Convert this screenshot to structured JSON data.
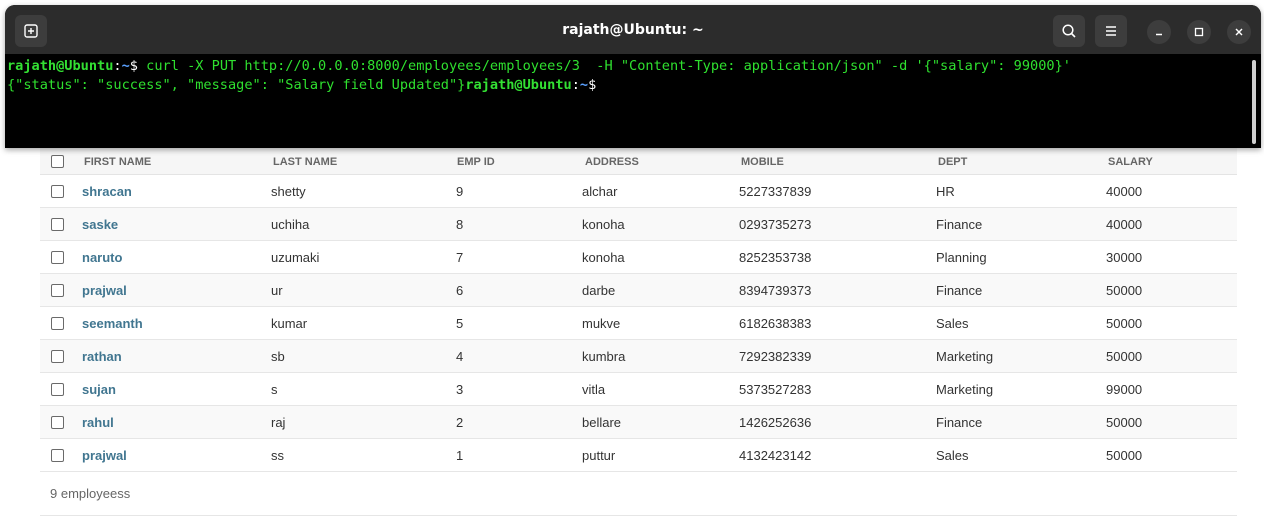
{
  "terminal": {
    "title": "rajath@Ubuntu: ~",
    "prompt_user": "rajath@Ubuntu",
    "prompt_sep": ":",
    "prompt_path": "~",
    "prompt_symbol": "$ ",
    "command": "curl -X PUT http://0.0.0.0:8000/employees/employees/3  -H \"Content-Type: application/json\" -d '{\"salary\": 99000}'",
    "output": "{\"status\": \"success\", \"message\": \"Salary field Updated\"}",
    "icons": {
      "new_tab": "new-tab-icon",
      "search": "search-icon",
      "menu": "hamburger-menu-icon",
      "minimize": "minimize-icon",
      "maximize": "maximize-icon",
      "close": "close-icon"
    }
  },
  "table": {
    "headers": [
      "FIRST NAME",
      "LAST NAME",
      "EMP ID",
      "ADDRESS",
      "MOBILE",
      "DEPT",
      "SALARY"
    ],
    "rows": [
      {
        "first": "shracan",
        "last": "shetty",
        "id": "9",
        "address": "alchar",
        "mobile": "5227337839",
        "dept": "HR",
        "salary": "40000"
      },
      {
        "first": "saske",
        "last": "uchiha",
        "id": "8",
        "address": "konoha",
        "mobile": "0293735273",
        "dept": "Finance",
        "salary": "40000"
      },
      {
        "first": "naruto",
        "last": "uzumaki",
        "id": "7",
        "address": "konoha",
        "mobile": "8252353738",
        "dept": "Planning",
        "salary": "30000"
      },
      {
        "first": "prajwal",
        "last": "ur",
        "id": "6",
        "address": "darbe",
        "mobile": "8394739373",
        "dept": "Finance",
        "salary": "50000"
      },
      {
        "first": "seemanth",
        "last": "kumar",
        "id": "5",
        "address": "mukve",
        "mobile": "6182638383",
        "dept": "Sales",
        "salary": "50000"
      },
      {
        "first": "rathan",
        "last": "sb",
        "id": "4",
        "address": "kumbra",
        "mobile": "7292382339",
        "dept": "Marketing",
        "salary": "50000"
      },
      {
        "first": "sujan",
        "last": "s",
        "id": "3",
        "address": "vitla",
        "mobile": "5373527283",
        "dept": "Marketing",
        "salary": "99000"
      },
      {
        "first": "rahul",
        "last": "raj",
        "id": "2",
        "address": "bellare",
        "mobile": "1426252636",
        "dept": "Finance",
        "salary": "50000"
      },
      {
        "first": "prajwal",
        "last": "ss",
        "id": "1",
        "address": "puttur",
        "mobile": "4132423142",
        "dept": "Sales",
        "salary": "50000"
      }
    ],
    "footer": "9 employeess"
  },
  "colors": {
    "terminal_green": "#2fe02f",
    "prompt_path_blue": "#5aa0ff",
    "link_blue": "#417690"
  }
}
